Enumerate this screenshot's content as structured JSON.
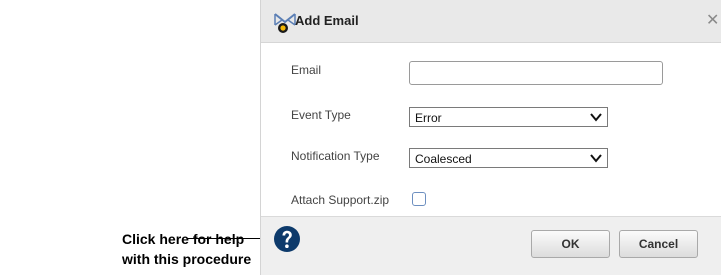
{
  "callout": {
    "line1": "Click here for help",
    "line2": "with this procedure"
  },
  "dialog": {
    "title": "Add Email",
    "title_icon": "email-add-icon",
    "close_glyph": "✕",
    "fields": {
      "email_label": "Email",
      "email_value": "",
      "event_type_label": "Event Type",
      "event_type_value": "Error",
      "notification_type_label": "Notification Type",
      "notification_type_value": "Coalesced",
      "attach_label": "Attach Support.zip",
      "attach_checked": false
    },
    "footer": {
      "help_icon": "help-icon",
      "ok_label": "OK",
      "cancel_label": "Cancel"
    }
  },
  "colors": {
    "title_bar": "#e9e9e9",
    "footer": "#efefef",
    "help_icon": "#0d3a6b",
    "checkbox_border": "#6d8fc0"
  }
}
